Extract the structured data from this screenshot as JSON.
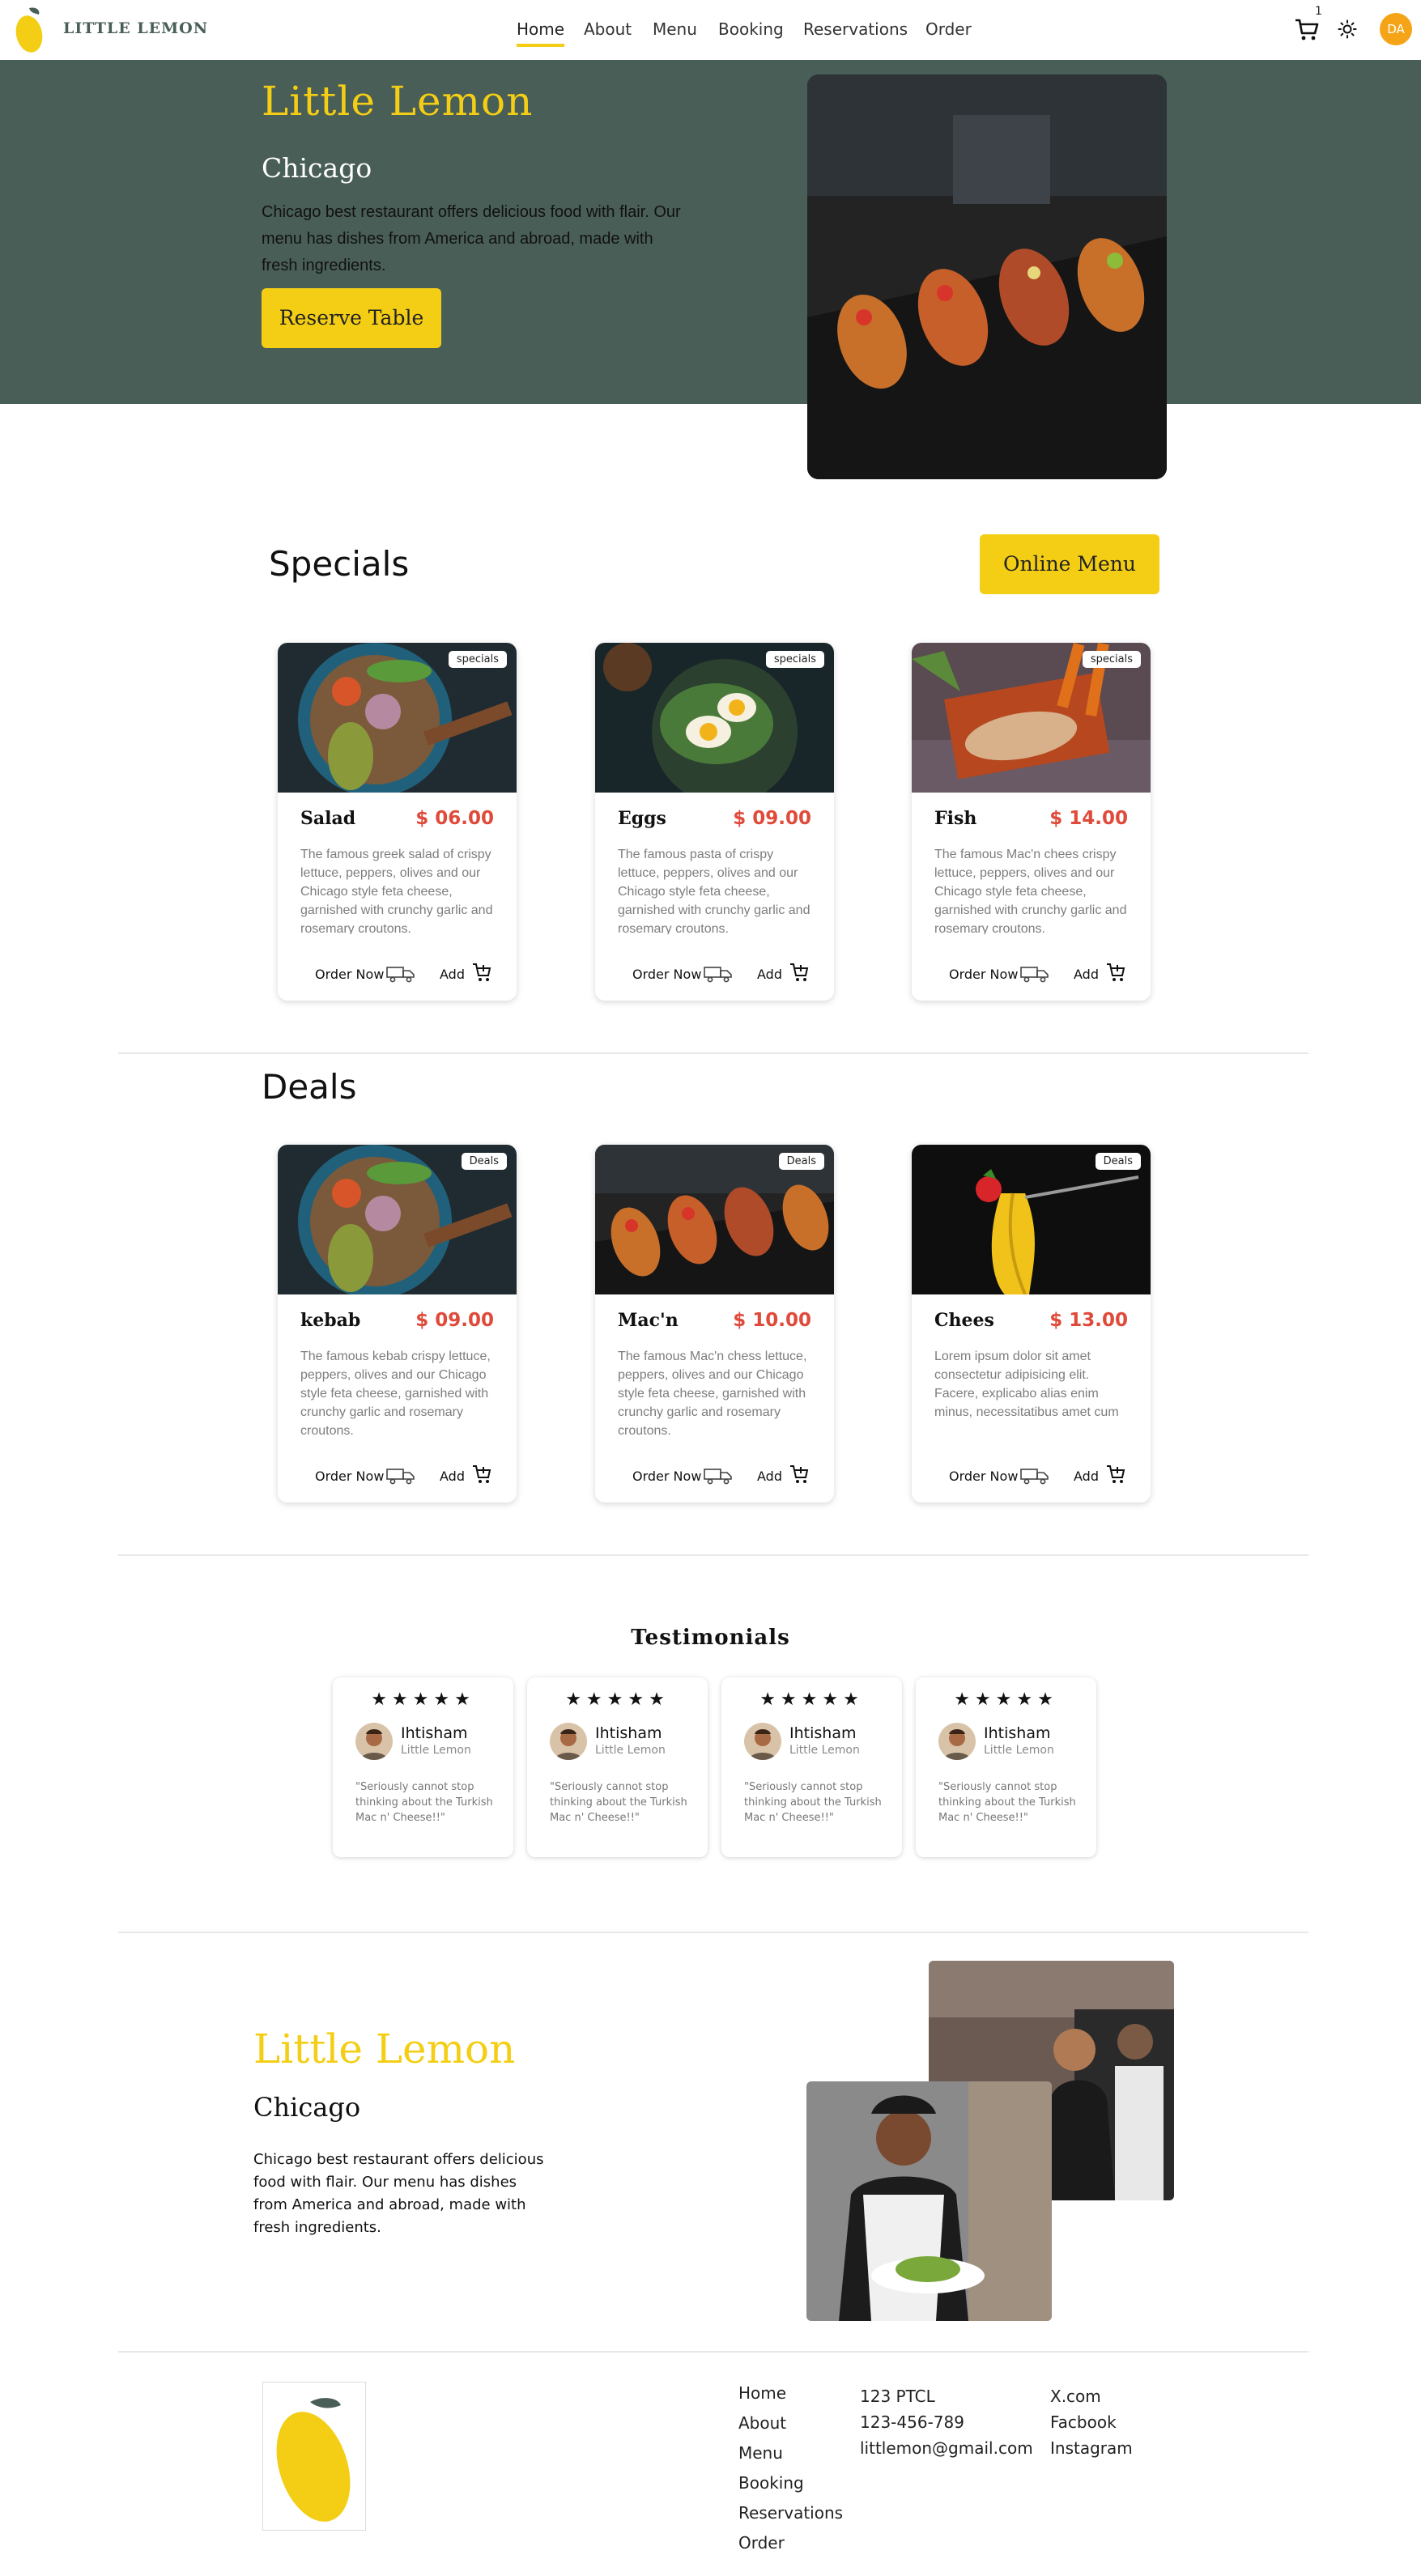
{
  "nav": {
    "brand": "LITTLE LEMON",
    "links": [
      "Home",
      "About",
      "Menu",
      "Booking",
      "Reservations",
      "Order"
    ],
    "cart_count": "1",
    "avatar_initials": "DA"
  },
  "hero": {
    "title": "Little Lemon",
    "subtitle": "Chicago",
    "description": "Chicago best restaurant offers delicious food with flair. Our menu has dishes from America and abroad, made with fresh ingredients.",
    "button": "Reserve Table"
  },
  "specials": {
    "title": "Specials",
    "button": "Online Menu",
    "items": [
      {
        "tag": "specials",
        "name": "Salad",
        "price": "$ 06.00",
        "desc": "The famous greek salad of crispy lettuce, peppers, olives and our Chicago style feta cheese, garnished with crunchy garlic and rosemary croutons.",
        "order": "Order Now",
        "add": "Add"
      },
      {
        "tag": "specials",
        "name": "Eggs",
        "price": "$ 09.00",
        "desc": "The famous pasta of crispy lettuce, peppers, olives and our Chicago style feta cheese, garnished with crunchy garlic and rosemary croutons.",
        "order": "Order Now",
        "add": "Add"
      },
      {
        "tag": "specials",
        "name": "Fish",
        "price": "$ 14.00",
        "desc": "The famous Mac'n chees crispy lettuce, peppers, olives and our Chicago style feta cheese, garnished with crunchy garlic and rosemary croutons.",
        "order": "Order Now",
        "add": "Add"
      }
    ]
  },
  "deals": {
    "title": "Deals",
    "items": [
      {
        "tag": "Deals",
        "name": "kebab",
        "price": "$ 09.00",
        "desc": "The famous kebab crispy lettuce, peppers, olives and our Chicago style feta cheese, garnished with crunchy garlic and rosemary croutons.",
        "order": "Order Now",
        "add": "Add"
      },
      {
        "tag": "Deals",
        "name": "Mac'n",
        "price": "$ 10.00",
        "desc": "The famous Mac'n chess lettuce, peppers, olives and our Chicago style feta cheese, garnished with crunchy garlic and rosemary croutons.",
        "order": "Order Now",
        "add": "Add"
      },
      {
        "tag": "Deals",
        "name": "Chees",
        "price": "$ 13.00",
        "desc": "Lorem ipsum dolor sit amet consectetur adipisicing elit. Facere, explicabo alias enim minus, necessitatibus amet cum",
        "order": "Order Now",
        "add": "Add"
      }
    ]
  },
  "testimonials": {
    "title": "Testimonials",
    "items": [
      {
        "stars": "★★★★★",
        "name": "Ihtisham",
        "role": "Little Lemon",
        "quote": "\"Seriously cannot stop thinking about the Turkish Mac n' Cheese!!\""
      },
      {
        "stars": "★★★★★",
        "name": "Ihtisham",
        "role": "Little Lemon",
        "quote": "\"Seriously cannot stop thinking about the Turkish Mac n' Cheese!!\""
      },
      {
        "stars": "★★★★★",
        "name": "Ihtisham",
        "role": "Little Lemon",
        "quote": "\"Seriously cannot stop thinking about the Turkish Mac n' Cheese!!\""
      },
      {
        "stars": "★★★★★",
        "name": "Ihtisham",
        "role": "Little Lemon",
        "quote": "\"Seriously cannot stop thinking about the Turkish Mac n' Cheese!!\""
      }
    ]
  },
  "about": {
    "title": "Little Lemon",
    "subtitle": "Chicago",
    "description": "Chicago best restaurant offers delicious food with flair. Our menu has dishes from America and abroad, made with fresh ingredients."
  },
  "footer": {
    "nav": [
      "Home",
      "About",
      "Menu",
      "Booking",
      "Reservations",
      "Order"
    ],
    "contact": [
      "123 PTCL",
      "123-456-789",
      "littlemon@gmail.com"
    ],
    "social": [
      "X.com",
      "Facbook",
      "Instagram"
    ]
  },
  "colors": {
    "primary": "#495e57",
    "accent": "#f4ce14",
    "price": "#e04a3a",
    "avatar": "#f4a416"
  }
}
